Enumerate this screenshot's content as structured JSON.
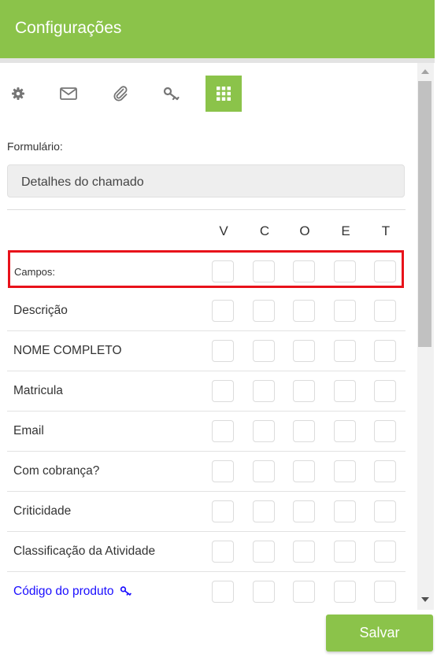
{
  "header": {
    "title": "Configurações"
  },
  "tabs": [
    {
      "icon": "gear-icon",
      "active": false
    },
    {
      "icon": "envelope-icon",
      "active": false
    },
    {
      "icon": "paperclip-icon",
      "active": false
    },
    {
      "icon": "key-icon",
      "active": false
    },
    {
      "icon": "grid-icon",
      "active": true
    }
  ],
  "form": {
    "label": "Formulário:",
    "selected": "Detalhes do chamado"
  },
  "columns": [
    "V",
    "C",
    "O",
    "E",
    "T"
  ],
  "campos_label": "Campos:",
  "rows": [
    {
      "label": "Descrição",
      "link": false
    },
    {
      "label": "NOME COMPLETO",
      "link": false
    },
    {
      "label": "Matricula",
      "link": false
    },
    {
      "label": "Email",
      "link": false
    },
    {
      "label": "Com cobrança?",
      "link": false
    },
    {
      "label": "Criticidade",
      "link": false
    },
    {
      "label": "Classificação da Atividade",
      "link": false
    },
    {
      "label": "Código do produto",
      "link": true,
      "icon": "key-icon"
    }
  ],
  "save_label": "Salvar",
  "colors": {
    "accent": "#8bc34a",
    "highlight": "#e8121a",
    "link": "#1a0dff"
  }
}
